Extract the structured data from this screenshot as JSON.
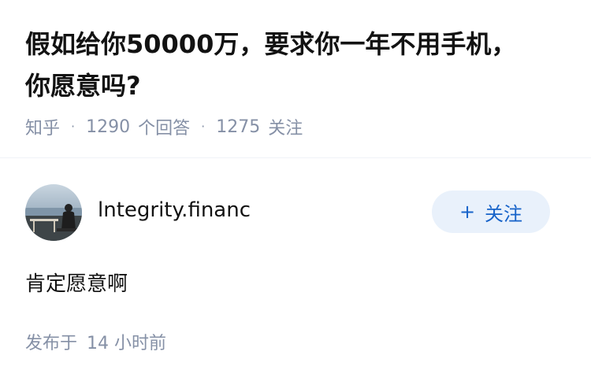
{
  "question": {
    "title_line1": "假如给你50000万，要求你一年不用手机，",
    "title_line2": "你愿意吗?",
    "source": "知乎",
    "separator": "·",
    "answer_count": "1290",
    "answer_label": "个回答",
    "follower_count": "1275",
    "follower_label": "关注"
  },
  "answer": {
    "author_name": "lntegrity.financ",
    "follow_plus": "+",
    "follow_label": "关注",
    "content": "肯定愿意啊",
    "published_label": "发布于",
    "published_time": "14 小时前"
  },
  "colors": {
    "title": "#121212",
    "meta": "#8590a6",
    "follow_bg": "#e9f1fb",
    "follow_text": "#1763c9",
    "divider": "#f0f2f7"
  }
}
